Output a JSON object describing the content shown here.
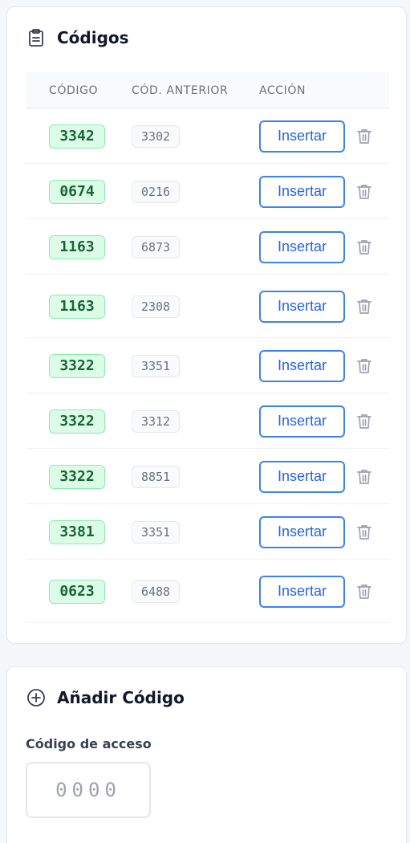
{
  "codes_card": {
    "title": "Códigos",
    "icon": "clipboard-icon",
    "columns": {
      "code": "CÓDIGO",
      "previous": "CÓD. ANTERIOR",
      "action": "ACCIÓN"
    },
    "rows": [
      {
        "code": "3342",
        "previous": "3302",
        "action_label": "Insertar"
      },
      {
        "code": "0674",
        "previous": "0216",
        "action_label": "Insertar"
      },
      {
        "code": "1163",
        "previous": "6873",
        "action_label": "Insertar"
      },
      {
        "code": "1163",
        "previous": "2308",
        "action_label": "Insertar"
      },
      {
        "code": "3322",
        "previous": "3351",
        "action_label": "Insertar"
      },
      {
        "code": "3322",
        "previous": "3312",
        "action_label": "Insertar"
      },
      {
        "code": "3322",
        "previous": "8851",
        "action_label": "Insertar"
      },
      {
        "code": "3381",
        "previous": "3351",
        "action_label": "Insertar"
      },
      {
        "code": "0623",
        "previous": "6488",
        "action_label": "Insertar"
      }
    ]
  },
  "add_card": {
    "title": "Añadir Código",
    "icon": "plus-circle-icon",
    "field_label": "Código de acceso",
    "input": {
      "value": "",
      "placeholder": "0000"
    }
  },
  "colors": {
    "accent": "#3b82f6",
    "code_badge_bg": "#dcfce7",
    "code_badge_text": "#166534"
  }
}
